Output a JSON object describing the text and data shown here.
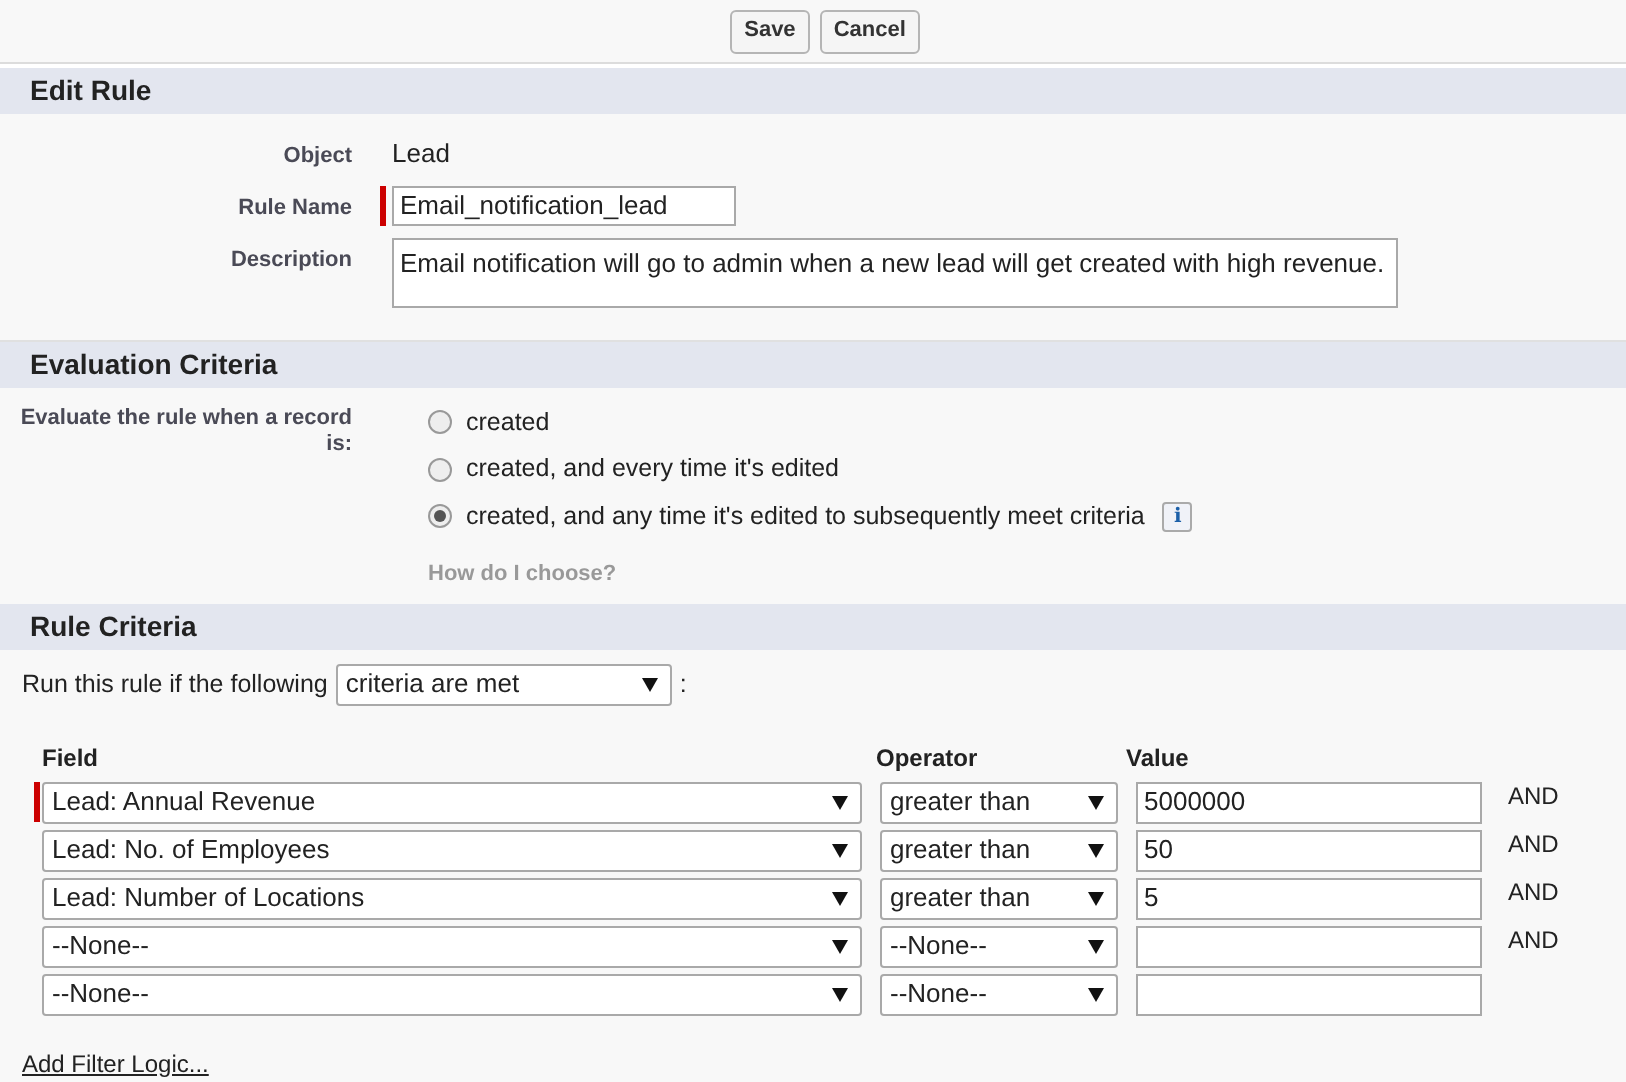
{
  "buttons": [
    "Save",
    "Cancel"
  ],
  "edit_rule": {
    "title": "Edit Rule",
    "fields": [
      {
        "kind": "text",
        "label": "Object",
        "value": "Lead"
      },
      {
        "kind": "input",
        "label": "Rule Name",
        "value": "Email_notification_lead",
        "required": true
      },
      {
        "kind": "textarea",
        "label": "Description",
        "value": "Email notification will go to admin when a new lead will get created with high revenue."
      }
    ]
  },
  "evaluation_criteria": {
    "title": "Evaluation Criteria",
    "label": "Evaluate the rule when a record is:",
    "options": [
      {
        "label": "created",
        "selected": false
      },
      {
        "label": "created, and every time it's edited",
        "selected": false
      },
      {
        "label": "created, and any time it's edited to subsequently meet criteria",
        "selected": true
      }
    ],
    "info_button": "i",
    "help_link": "How do I choose?"
  },
  "rule_criteria": {
    "title": "Rule Criteria",
    "run_label": "Run this rule if the following",
    "run_value": "criteria are met",
    "run_suffix": ":",
    "columns": [
      "Field",
      "Operator",
      "Value"
    ],
    "rows": [
      {
        "field": "Lead: Annual Revenue",
        "operator": "greater than",
        "value": "5000000",
        "connector": "AND",
        "required": true
      },
      {
        "field": "Lead: No. of Employees",
        "operator": "greater than",
        "value": "50",
        "connector": "AND",
        "required": false
      },
      {
        "field": "Lead: Number of Locations",
        "operator": "greater than",
        "value": "5",
        "connector": "AND",
        "required": false
      },
      {
        "field": "--None--",
        "operator": "--None--",
        "connector": "AND",
        "required": false
      },
      {
        "field": "--None--",
        "operator": "--None--",
        "required": false
      }
    ],
    "filter_logic_link": "Add Filter Logic..."
  }
}
